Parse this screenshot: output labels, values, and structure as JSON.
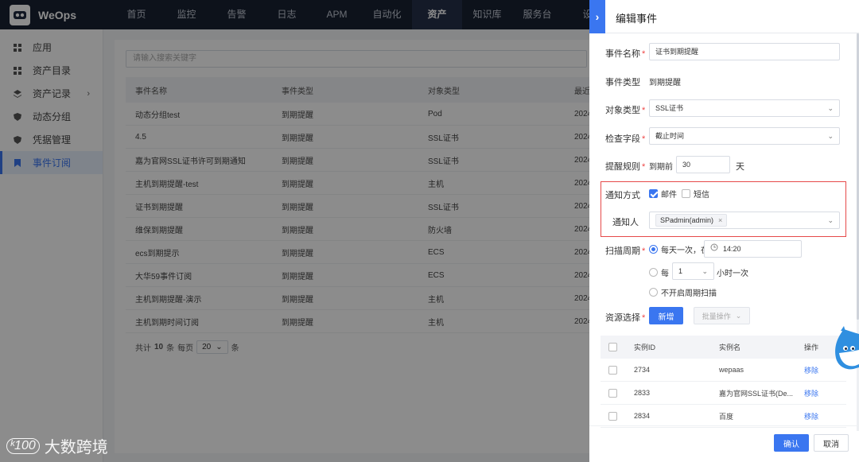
{
  "app": {
    "name": "WeOps"
  },
  "topnav": [
    "首页",
    "监控",
    "告警",
    "日志",
    "APM",
    "自动化",
    "资产",
    "知识库",
    "服务台",
    "设"
  ],
  "topnav_active_index": 6,
  "sidebar": {
    "items": [
      {
        "label": "应用",
        "icon": "grid-icon"
      },
      {
        "label": "资产目录",
        "icon": "grid-icon"
      },
      {
        "label": "资产记录",
        "icon": "layers-icon",
        "has_children": true
      },
      {
        "label": "动态分组",
        "icon": "shield-icon"
      },
      {
        "label": "凭据管理",
        "icon": "shield-icon"
      },
      {
        "label": "事件订阅",
        "icon": "bookmark-icon",
        "active": true
      }
    ]
  },
  "main": {
    "search_placeholder": "请输入搜索关键字",
    "columns": [
      "事件名称",
      "事件类型",
      "对象类型",
      "最近"
    ],
    "rows": [
      [
        "动态分组test",
        "到期提醒",
        "Pod",
        "2024"
      ],
      [
        "4.5",
        "到期提醒",
        "SSL证书",
        "2024"
      ],
      [
        "嘉为官网SSL证书许可到期通知",
        "到期提醒",
        "SSL证书",
        "2024"
      ],
      [
        "主机到期提醒-test",
        "到期提醒",
        "主机",
        "2024"
      ],
      [
        "证书到期提醒",
        "到期提醒",
        "SSL证书",
        "2024"
      ],
      [
        "维保到期提醒",
        "到期提醒",
        "防火墙",
        "2024"
      ],
      [
        "ecs到期提示",
        "到期提醒",
        "ECS",
        "2024"
      ],
      [
        "大华59事件订阅",
        "到期提醒",
        "ECS",
        "2024"
      ],
      [
        "主机到期提醒-演示",
        "到期提醒",
        "主机",
        "2024"
      ],
      [
        "主机到期时间订阅",
        "到期提醒",
        "主机",
        "2024"
      ]
    ],
    "pager": {
      "total_prefix": "共计",
      "total": "10",
      "total_suffix": "条",
      "per_page_label": "每页",
      "per_page": "20",
      "per_page_suffix": "条"
    }
  },
  "watermark": {
    "logo": "ᵏ100",
    "text": "大数跨境"
  },
  "drawer": {
    "title": "编辑事件",
    "toggle_glyph": "›",
    "fields": {
      "event_name": {
        "label": "事件名称",
        "value": "证书到期提醒"
      },
      "event_type": {
        "label": "事件类型",
        "value": "到期提醒"
      },
      "object_type": {
        "label": "对象类型",
        "value": "SSL证书"
      },
      "check_field": {
        "label": "检查字段",
        "value": "截止时间"
      },
      "rule": {
        "label": "提醒规则",
        "prefix": "到期前",
        "value": "30",
        "suffix": "天"
      },
      "notify_method": {
        "label": "通知方式",
        "options": [
          {
            "label": "邮件",
            "checked": true
          },
          {
            "label": "短信",
            "checked": false
          }
        ]
      },
      "notify_person": {
        "label": "通知人",
        "tag": "SPadmin(admin)"
      },
      "scan": {
        "label": "扫描周期",
        "daily_label": "每天一次，在",
        "time": "14:20",
        "every_prefix": "每",
        "hours": "1",
        "every_suffix": "小时一次",
        "disable_label": "不开启周期扫描"
      },
      "resource": {
        "label": "资源选择",
        "add_button": "新增",
        "batch_button": "批量操作"
      }
    },
    "resource_table": {
      "columns": [
        "实例ID",
        "实例名",
        "操作"
      ],
      "rows": [
        {
          "id": "2734",
          "name": "wepaas",
          "action": "移除"
        },
        {
          "id": "2833",
          "name": "嘉为官网SSL证书(De...",
          "action": "移除"
        },
        {
          "id": "2834",
          "name": "百度",
          "action": "移除"
        }
      ]
    },
    "footer": {
      "confirm": "确认",
      "cancel": "取消"
    }
  },
  "colors": {
    "primary": "#3a76f0",
    "topbar": "#182132",
    "highlight_border": "#e64a4a",
    "required": "#ee4444"
  }
}
